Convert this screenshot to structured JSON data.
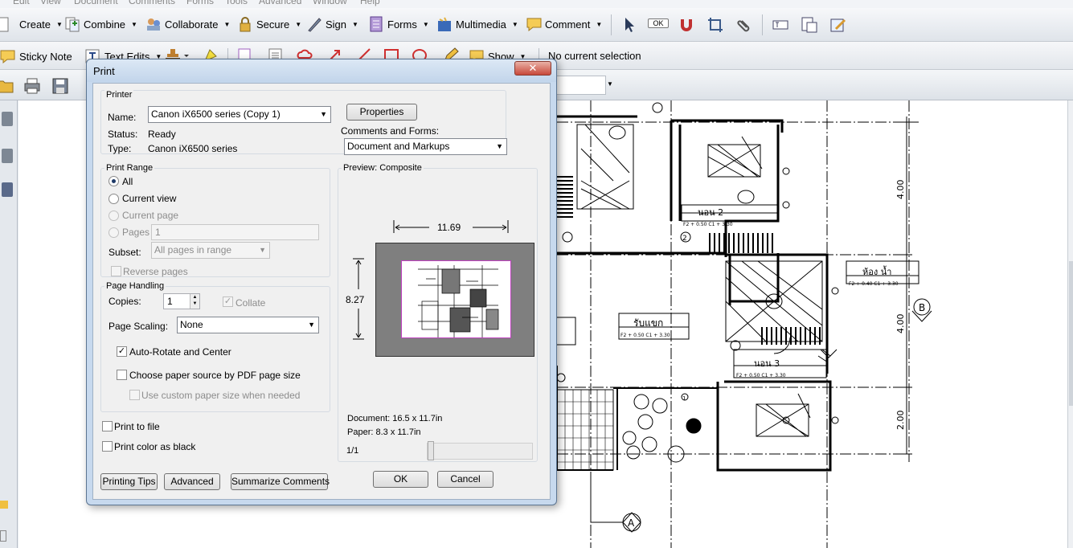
{
  "menu": [
    "Edit",
    "View",
    "Document",
    "Comments",
    "Forms",
    "Tools",
    "Advanced",
    "Window",
    "Help"
  ],
  "toolbar1": {
    "create": "Create",
    "combine": "Combine",
    "collaborate": "Collaborate",
    "secure": "Secure",
    "sign": "Sign",
    "forms": "Forms",
    "multimedia": "Multimedia",
    "comment": "Comment",
    "ok_badge": "OK"
  },
  "toolbar2": {
    "sticky_note": "Sticky Note",
    "text_edits": "Text Edits",
    "show": "Show",
    "selection_status": "No current selection"
  },
  "dialog": {
    "title": "Print",
    "close": "✕",
    "printer": {
      "group_label": "Printer",
      "name_label": "Name:",
      "name_value": "Canon iX6500 series (Copy 1)",
      "status_label": "Status:",
      "status_value": "Ready",
      "type_label": "Type:",
      "type_value": "Canon iX6500 series",
      "properties": "Properties",
      "comments_forms_label": "Comments and Forms:",
      "comments_forms_value": "Document and Markups"
    },
    "print_range": {
      "group_label": "Print Range",
      "all": "All",
      "current_view": "Current view",
      "current_page": "Current page",
      "pages": "Pages",
      "pages_value": "1",
      "subset_label": "Subset:",
      "subset_value": "All pages in range",
      "reverse_pages": "Reverse pages"
    },
    "page_handling": {
      "group_label": "Page Handling",
      "copies_label": "Copies:",
      "copies_value": "1",
      "collate": "Collate",
      "page_scaling_label": "Page Scaling:",
      "page_scaling_value": "None",
      "auto_rotate": "Auto-Rotate and Center",
      "choose_paper_source": "Choose paper source by PDF page size",
      "custom_paper_size": "Use custom paper size when needed"
    },
    "print_to_file": "Print to file",
    "print_color_as_black": "Print color as black",
    "preview": {
      "label": "Preview: Composite",
      "width": "11.69",
      "height": "8.27",
      "document_size": "Document: 16.5 x 11.7in",
      "paper_size": "Paper: 8.3 x 11.7in",
      "page_counter": "1/1"
    },
    "buttons": {
      "printing_tips": "Printing Tips",
      "advanced": "Advanced",
      "summarize_comments": "Summarize Comments",
      "ok": "OK",
      "cancel": "Cancel"
    }
  },
  "drawing_labels": {
    "room1": "นอน 2",
    "room2": "ห้อง น้ำ",
    "room3": "รับแขก",
    "room4": "นอน 3",
    "dim1": "4.00",
    "dim2": "4.00",
    "dim3": "2.00",
    "axis_b": "B",
    "axis_a": "A",
    "tag1": "F2 + 0.50 C1 + 3.30",
    "tag2": "F2 + 0.50 C1 + 3.30",
    "tag3": "F2 + 0.50 C1 + 3.30",
    "tag4": "F2 + 0.40 C1 + 3.30",
    "n1": "1",
    "n2": "2"
  }
}
